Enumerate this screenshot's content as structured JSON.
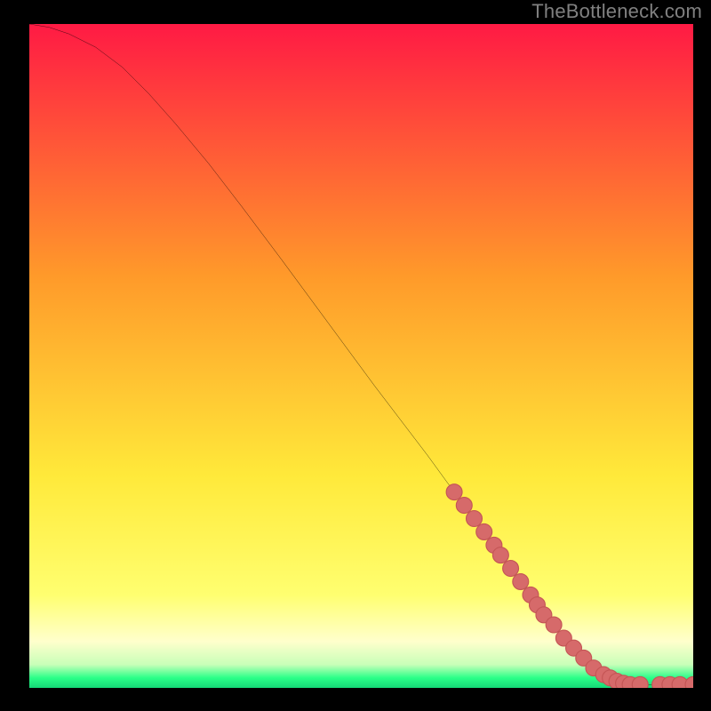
{
  "attribution": "TheBottleneck.com",
  "colors": {
    "curve": "#000000",
    "marker_fill": "#d66a6a",
    "marker_stroke": "#c45555",
    "bg_top": "#ff1a44",
    "bg_mid1": "#ff9a2a",
    "bg_mid2": "#ffe93a",
    "bg_pale": "#ffffcc",
    "bg_green": "#2aff88",
    "frame": "#000000"
  },
  "chart_data": {
    "type": "line",
    "title": "",
    "xlabel": "",
    "ylabel": "",
    "xlim": [
      0,
      100
    ],
    "ylim": [
      0,
      100
    ],
    "curve": {
      "x": [
        0,
        3,
        6,
        10,
        14,
        18,
        22,
        27,
        32,
        38,
        45,
        52,
        60,
        68,
        74,
        78,
        81,
        84,
        87,
        89,
        91,
        94,
        96.5,
        98,
        100
      ],
      "y": [
        100,
        99.5,
        98.5,
        96.5,
        93.5,
        89.5,
        85,
        79,
        72.5,
        64.5,
        55,
        45.5,
        35,
        24,
        16,
        10.5,
        6.5,
        3.5,
        1.5,
        0.7,
        0.5,
        0.5,
        0.5,
        0.5,
        0.5
      ]
    },
    "series": [
      {
        "name": "markers",
        "x": [
          64,
          65.5,
          67,
          68.5,
          70,
          71,
          72.5,
          74,
          75.5,
          76.5,
          77.5,
          79,
          80.5,
          82,
          83.5,
          85,
          86.5,
          87.5,
          88.5,
          89.5,
          90.5,
          92,
          95,
          96.5,
          98,
          100
        ],
        "y": [
          29.5,
          27.5,
          25.5,
          23.5,
          21.5,
          20,
          18,
          16,
          14,
          12.5,
          11,
          9.5,
          7.5,
          6,
          4.5,
          3,
          2,
          1.5,
          1,
          0.7,
          0.5,
          0.5,
          0.5,
          0.5,
          0.5,
          0.5
        ]
      }
    ]
  }
}
